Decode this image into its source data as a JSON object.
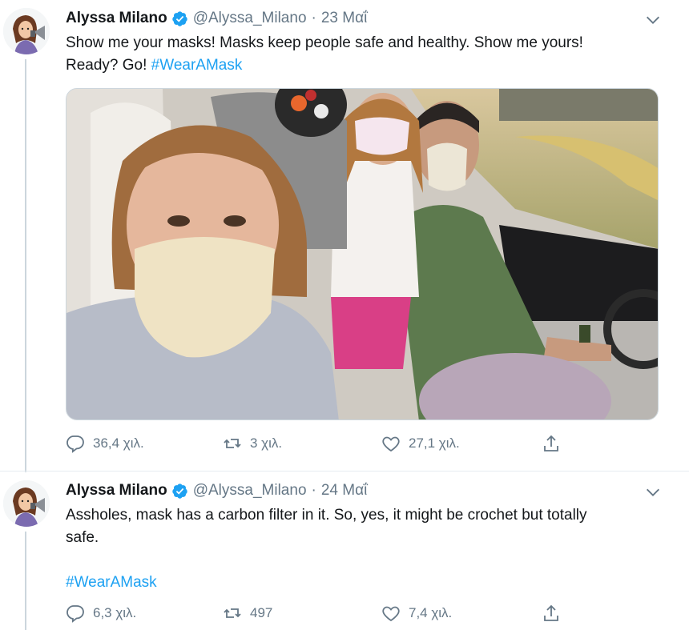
{
  "tweets": [
    {
      "author": "Alyssa Milano",
      "handle": "@Alyssa_Milano",
      "separator": "·",
      "date": "23 Μαΐ",
      "text_line1": "Show me your masks! Masks keep people safe and healthy. Show me yours!",
      "text_line2_prefix": "Ready? Go! ",
      "hashtag": "#WearAMask",
      "replies": "36,4 χιλ.",
      "retweets": "3 χιλ.",
      "likes": "27,1 χιλ."
    },
    {
      "author": "Alyssa Milano",
      "handle": "@Alyssa_Milano",
      "separator": "·",
      "date": "24 Μαΐ",
      "text_line1": "Assholes, mask has a carbon filter in it. So, yes, it might be crochet but totally",
      "text_line2": "safe.",
      "hashtag": "#WearAMask",
      "replies": "6,3 χιλ.",
      "retweets": "497",
      "likes": "7,4 χιλ."
    }
  ],
  "icons": {
    "reply": "reply-icon",
    "retweet": "retweet-icon",
    "like": "heart-icon",
    "share": "share-icon",
    "verified": "verified-badge-icon",
    "menu": "chevron-down-icon"
  },
  "colors": {
    "link": "#1da1f2",
    "secondary_text": "#657786",
    "primary_text": "#14171a"
  }
}
